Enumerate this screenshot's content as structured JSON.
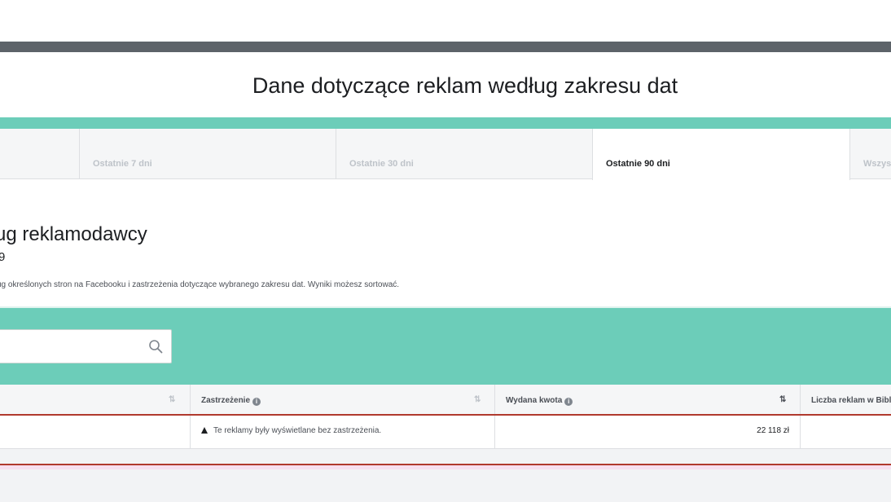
{
  "page_title": "Dane dotyczące reklam według zakresu dat",
  "tabs": [
    {
      "label": "Ostatnie 7 dni",
      "active": false
    },
    {
      "label": "Ostatnie 30 dni",
      "active": false
    },
    {
      "label": "Ostatnie 90 dni",
      "active": true
    },
    {
      "label": "Wszystkie",
      "active": false
    }
  ],
  "section": {
    "heading": "ug reklamodawcy",
    "subheading": "9",
    "description": "ug określonych stron na Facebooku i zastrzeżenia dotyczące wybranego zakresu dat. Wyniki możesz sortować."
  },
  "search": {
    "placeholder": "",
    "icon": "search-icon"
  },
  "table": {
    "columns": [
      {
        "label": "",
        "sort": "⇅"
      },
      {
        "label": "Zastrzeżenie",
        "info": "i",
        "sort": "⇅"
      },
      {
        "label": "Wydana kwota",
        "info": "i",
        "sort": "⇅"
      },
      {
        "label": "Liczba reklam w Bibliotece",
        "sort": ""
      }
    ],
    "rows": [
      {
        "disclaimer": "Te reklamy były wyświetlane bez zastrzeżenia.",
        "amount": "22 118 zł",
        "count": ""
      }
    ]
  },
  "colors": {
    "accent": "#6ccdb9",
    "topbar": "#5d6369",
    "row_border": "#b03a2e"
  }
}
